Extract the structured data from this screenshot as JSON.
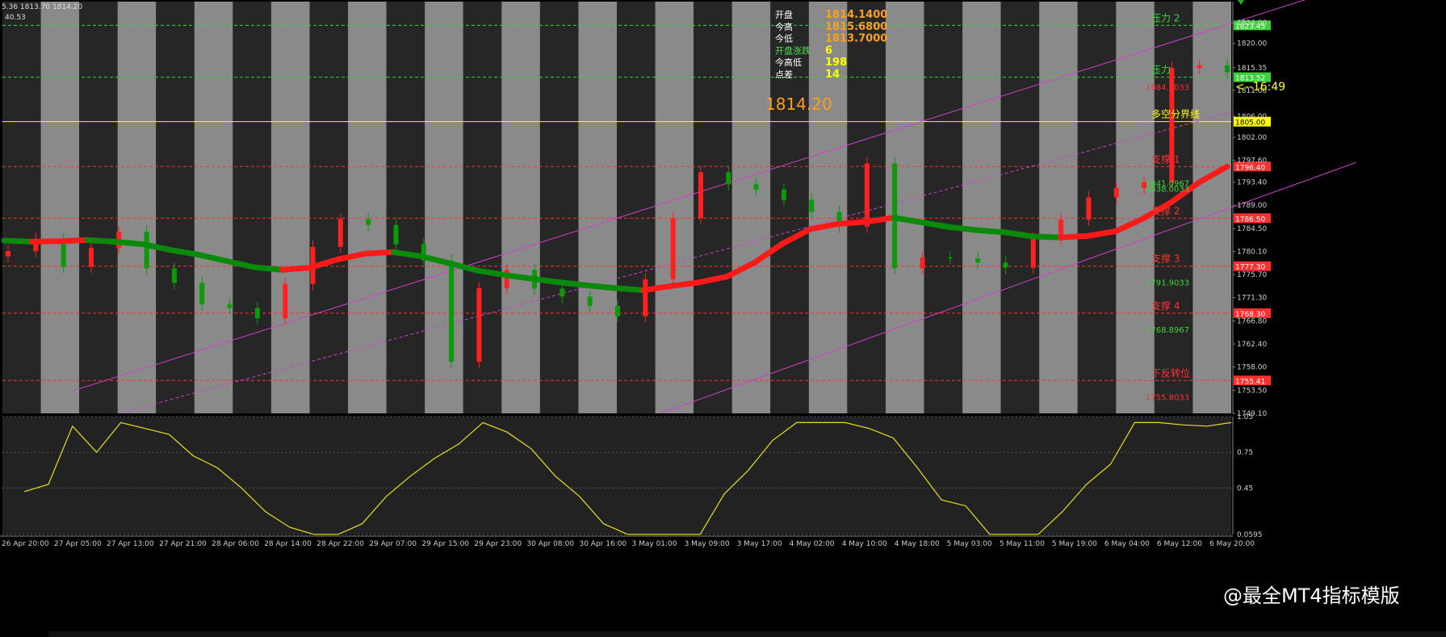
{
  "header": {
    "top_left_line1": "5.36 1813.70 1814.20",
    "top_left_line2": "40.53"
  },
  "info_panel": {
    "rows": [
      {
        "label": "开盘",
        "value": "1814.1400",
        "value_color": "#ff9f1a"
      },
      {
        "label": "今高",
        "value": "1815.6800",
        "value_color": "#ff9f1a"
      },
      {
        "label": "今低",
        "value": "1813.7000",
        "value_color": "#ff9f1a"
      },
      {
        "label": "开盘涨跌",
        "value": "6",
        "label_color": "#55dd55",
        "value_color": "#ffff00"
      },
      {
        "label": "今高低",
        "value": "198",
        "label_color": "#ffffff",
        "value_color": "#ffff00"
      },
      {
        "label": "点差",
        "value": "14",
        "label_color": "#ffffff",
        "value_color": "#ffff00"
      }
    ],
    "big_price": "1814.20",
    "timer": "<--16:49"
  },
  "colors": {
    "up_candle": "#ff2020",
    "down_candle": "#0a9a0a",
    "ma_up": "#ff1a1a",
    "ma_down": "#0a8a0a",
    "ma_cross": "#ffff00",
    "channel": "#d040d0",
    "oscillator": "#e8e020",
    "resistance_line": "#3ad33a",
    "support_line": "#ff3030",
    "pivot_line": "#ffff00",
    "panel_bg": "#222222",
    "band_dark": "#262626",
    "band_light": "#8a8a8a"
  },
  "levels": [
    {
      "name": "压力 2",
      "value": 1823.45,
      "color": "green",
      "tag": "1823.45"
    },
    {
      "name": "压力",
      "value": 1813.52,
      "color": "green",
      "tag": "1813.52",
      "note": "1884.1033"
    },
    {
      "name": "多空分界线",
      "value": 1805.0,
      "color": "yellow",
      "tag": "1805.00"
    },
    {
      "name": "支撑 1",
      "value": 1796.4,
      "color": "red",
      "tag": "1796.40",
      "note": "1841.0967",
      "note2": "1838.0033"
    },
    {
      "name": "支撑 2",
      "value": 1786.5,
      "color": "red",
      "tag": "1786.50"
    },
    {
      "name": "支撑 3",
      "value": 1777.3,
      "color": "red",
      "tag": "1777.30",
      "note": "1791.9033"
    },
    {
      "name": "支撑 4",
      "value": 1768.3,
      "color": "red",
      "tag": "1768.30",
      "note": "1768.8967"
    },
    {
      "name": "下反转位",
      "value": 1755.4,
      "color": "red",
      "tag": "1755.41",
      "note": "1755.8033"
    }
  ],
  "main_axis": {
    "ticks": [
      "1824.00",
      "1820.00",
      "1815.35",
      "1811.00",
      "1806.00",
      "1802.00",
      "1797.60",
      "1793.40",
      "1789.00",
      "1784.50",
      "1780.10",
      "1775.70",
      "1771.30",
      "1766.80",
      "1762.40",
      "1758.00",
      "1753.50",
      "1749.10"
    ],
    "ylim": [
      1749.1,
      1828.0
    ]
  },
  "osc_axis": {
    "ticks": [
      "1.05",
      "0.75",
      "0.45",
      "0.0595"
    ],
    "ylim": [
      0.0595,
      1.05
    ]
  },
  "time_axis": [
    "26 Apr 20:00",
    "27 Apr 05:00",
    "27 Apr 13:00",
    "27 Apr 21:00",
    "28 Apr 06:00",
    "28 Apr 14:00",
    "28 Apr 22:00",
    "29 Apr 07:00",
    "29 Apr 15:00",
    "29 Apr 23:00",
    "30 Apr 08:00",
    "30 Apr 16:00",
    "3 May 01:00",
    "3 May 09:00",
    "3 May 17:00",
    "4 May 02:00",
    "4 May 10:00",
    "4 May 18:00",
    "5 May 03:00",
    "5 May 11:00",
    "5 May 19:00",
    "6 May 04:00",
    "6 May 12:00",
    "6 May 20:00"
  ],
  "watermark": "@最全MT4指标模版",
  "chart_data": {
    "type": "candlestick",
    "ylim": [
      1749.1,
      1828.0
    ],
    "ma_path": [
      1782.2,
      1782.0,
      1782.1,
      1782.3,
      1782.0,
      1781.5,
      1780.4,
      1779.5,
      1778.3,
      1777.1,
      1776.6,
      1777.0,
      1778.6,
      1779.7,
      1780.0,
      1779.2,
      1777.9,
      1776.5,
      1775.6,
      1774.9,
      1774.2,
      1773.6,
      1773.1,
      1772.7,
      1773.5,
      1774.2,
      1775.3,
      1778.0,
      1781.6,
      1784.4,
      1785.4,
      1785.8,
      1786.6,
      1785.7,
      1784.8,
      1784.2,
      1783.8,
      1783.0,
      1782.8,
      1783.1,
      1784.0,
      1786.5,
      1789.6,
      1793.4,
      1796.4
    ],
    "closes": [
      1780.2,
      1782.5,
      1777.2,
      1780.8,
      1783.9,
      1776.9,
      1774.1,
      1770.0,
      1769.3,
      1767.3,
      1773.9,
      1781.0,
      1786.3,
      1785.2,
      1781.5,
      1778.4,
      1759.0,
      1773.1,
      1776.6,
      1773.0,
      1771.5,
      1769.7,
      1767.7,
      1774.8,
      1786.5,
      1795.3,
      1793.0,
      1792.0,
      1790.0,
      1787.7,
      1784.9,
      1797.0,
      1776.9,
      1779.0,
      1778.8,
      1778.0,
      1777.0,
      1782.6,
      1786.2,
      1790.5,
      1792.3,
      1793.4,
      1815.3,
      1815.8,
      1814.5
    ]
  },
  "oscillator": {
    "type": "line",
    "values": [
      0.42,
      0.48,
      0.97,
      0.75,
      1.0,
      0.95,
      0.9,
      0.72,
      0.62,
      0.45,
      0.25,
      0.12,
      0.06,
      0.06,
      0.15,
      0.38,
      0.55,
      0.7,
      0.82,
      1.0,
      0.92,
      0.78,
      0.55,
      0.38,
      0.15,
      0.06,
      0.06,
      0.06,
      0.06,
      0.4,
      0.6,
      0.85,
      1.0,
      1.0,
      1.0,
      0.95,
      0.87,
      0.62,
      0.35,
      0.3,
      0.06,
      0.06,
      0.06,
      0.25,
      0.48,
      0.65,
      1.0,
      1.0,
      0.98,
      0.97,
      1.0
    ]
  }
}
